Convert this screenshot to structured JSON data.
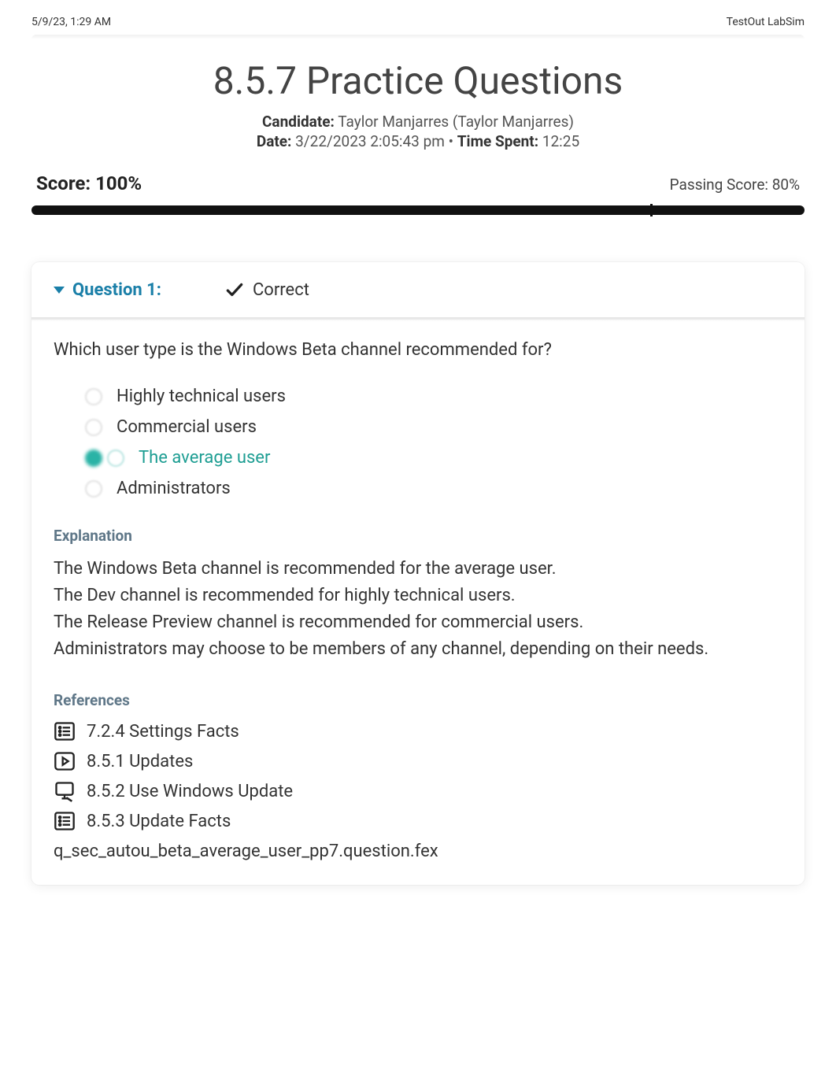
{
  "print_header": {
    "left": "5/9/23, 1:29 AM",
    "right": "TestOut LabSim"
  },
  "summary": {
    "title": "8.5.7 Practice Questions",
    "candidate_label": "Candidate:",
    "candidate_value": "Taylor Manjarres (Taylor Manjarres)",
    "date_label": "Date:",
    "date_value": "3/22/2023 2:05:43 pm",
    "separator": "•",
    "time_label": "Time Spent:",
    "time_value": "12:25",
    "score_label": "Score: 100%",
    "passing_label": "Passing Score: 80%",
    "passing_percent": 80
  },
  "question": {
    "header_label": "Question 1:",
    "status_label": "Correct",
    "prompt": "Which user type is the Windows Beta channel recommended for?",
    "options": [
      {
        "text": "Highly technical users",
        "selected": false
      },
      {
        "text": "Commercial users",
        "selected": false
      },
      {
        "text": "The average user",
        "selected": true
      },
      {
        "text": "Administrators",
        "selected": false
      }
    ],
    "explanation_heading": "Explanation",
    "explanation_lines": [
      "The Windows Beta channel is recommended for the average user.",
      "The Dev channel is recommended for highly technical users.",
      "The Release Preview channel is recommended for commercial users.",
      "Administrators may choose to be members of any channel, depending on their needs."
    ],
    "references_heading": "References",
    "references": [
      {
        "icon": "list",
        "text": "7.2.4 Settings Facts"
      },
      {
        "icon": "video",
        "text": "8.5.1 Updates"
      },
      {
        "icon": "lab",
        "text": "8.5.2 Use Windows Update"
      },
      {
        "icon": "list",
        "text": "8.5.3 Update Facts"
      }
    ],
    "question_file": "q_sec_autou_beta_average_user_pp7.question.fex"
  }
}
